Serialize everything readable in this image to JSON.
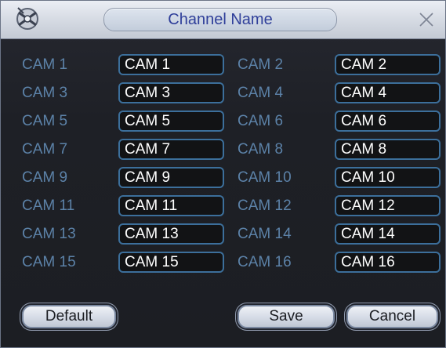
{
  "dialog": {
    "title": "Channel Name",
    "close_icon": "close-icon",
    "logo_icon": "app-logo-icon"
  },
  "channels": [
    {
      "label": "CAM 1",
      "value": "CAM 1"
    },
    {
      "label": "CAM 2",
      "value": "CAM 2"
    },
    {
      "label": "CAM 3",
      "value": "CAM 3"
    },
    {
      "label": "CAM 4",
      "value": "CAM 4"
    },
    {
      "label": "CAM 5",
      "value": "CAM 5"
    },
    {
      "label": "CAM 6",
      "value": "CAM 6"
    },
    {
      "label": "CAM 7",
      "value": "CAM 7"
    },
    {
      "label": "CAM 8",
      "value": "CAM 8"
    },
    {
      "label": "CAM 9",
      "value": "CAM 9"
    },
    {
      "label": "CAM 10",
      "value": "CAM 10"
    },
    {
      "label": "CAM 11",
      "value": "CAM 11"
    },
    {
      "label": "CAM 12",
      "value": "CAM 12"
    },
    {
      "label": "CAM 13",
      "value": "CAM 13"
    },
    {
      "label": "CAM 14",
      "value": "CAM 14"
    },
    {
      "label": "CAM 15",
      "value": "CAM 15"
    },
    {
      "label": "CAM 16",
      "value": "CAM 16"
    }
  ],
  "buttons": {
    "default": "Default",
    "save": "Save",
    "cancel": "Cancel"
  },
  "colors": {
    "label": "#5c82a8",
    "field_border": "#3c6f9b",
    "title_text": "#2f3f9a",
    "background": "#1c1e23"
  }
}
